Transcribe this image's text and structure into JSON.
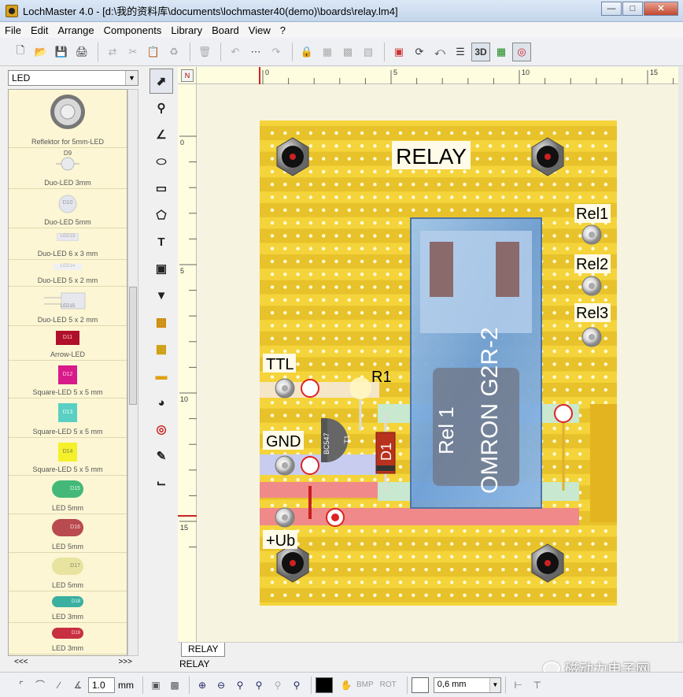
{
  "window": {
    "title": "LochMaster 4.0 - [d:\\我的资料库\\documents\\lochmaster40(demo)\\boards\\relay.lm4]"
  },
  "menu": [
    "File",
    "Edit",
    "Arrange",
    "Components",
    "Library",
    "Board",
    "View",
    "?"
  ],
  "toolbar": {
    "view3d_label": "3D"
  },
  "library": {
    "category": "LED",
    "items": [
      {
        "label": "Reflektor for 5mm-LED",
        "code": ""
      },
      {
        "label": "Duo-LED 3mm",
        "code": "D9"
      },
      {
        "label": "Duo-LED 5mm",
        "code": "D10"
      },
      {
        "label": "Duo-LED 6 x 3 mm",
        "code": "LED13"
      },
      {
        "label": "Duo-LED 5 x 2 mm",
        "code": "LED14"
      },
      {
        "label": "Duo-LED 5 x 2 mm",
        "code": "LED15"
      },
      {
        "label": "Arrow-LED",
        "code": "D11"
      },
      {
        "label": "Square-LED 5 x 5 mm",
        "code": "D12"
      },
      {
        "label": "Square-LED 5 x 5 mm",
        "code": "D13"
      },
      {
        "label": "Square-LED 5 x 5 mm",
        "code": "D14"
      },
      {
        "label": "LED 5mm",
        "code": "D15"
      },
      {
        "label": "LED 5mm",
        "code": "D16"
      },
      {
        "label": "LED 5mm",
        "code": "D17"
      },
      {
        "label": "LED 3mm",
        "code": "D18"
      },
      {
        "label": "LED 3mm",
        "code": "D19"
      }
    ],
    "nav_prev": "<<<",
    "nav_next": ">>>"
  },
  "ruler": {
    "h_ticks": [
      "0",
      "5",
      "10",
      "15"
    ],
    "v_ticks": [
      "0",
      "5",
      "10",
      "15"
    ],
    "corner": "N"
  },
  "board": {
    "title": "RELAY",
    "labels": {
      "ttl": "TTL",
      "gnd": "GND",
      "ub": "+Ub",
      "rel1": "Rel1",
      "rel2": "Rel2",
      "rel3": "Rel3",
      "r1": "R1",
      "d1": "D1"
    },
    "relay_text": {
      "ref": "Rel 1",
      "part": "OMRON G2R-2"
    },
    "transistor": {
      "ref": "T1",
      "part": "BC547"
    }
  },
  "tabs": [
    "RELAY"
  ],
  "status": "RELAY",
  "bottombar": {
    "grid_value": "1.0",
    "grid_unit": "mm",
    "bmp": "BMP",
    "rot": "ROT",
    "width_value": "0,6 mm"
  },
  "watermark": "磁动力电子网"
}
